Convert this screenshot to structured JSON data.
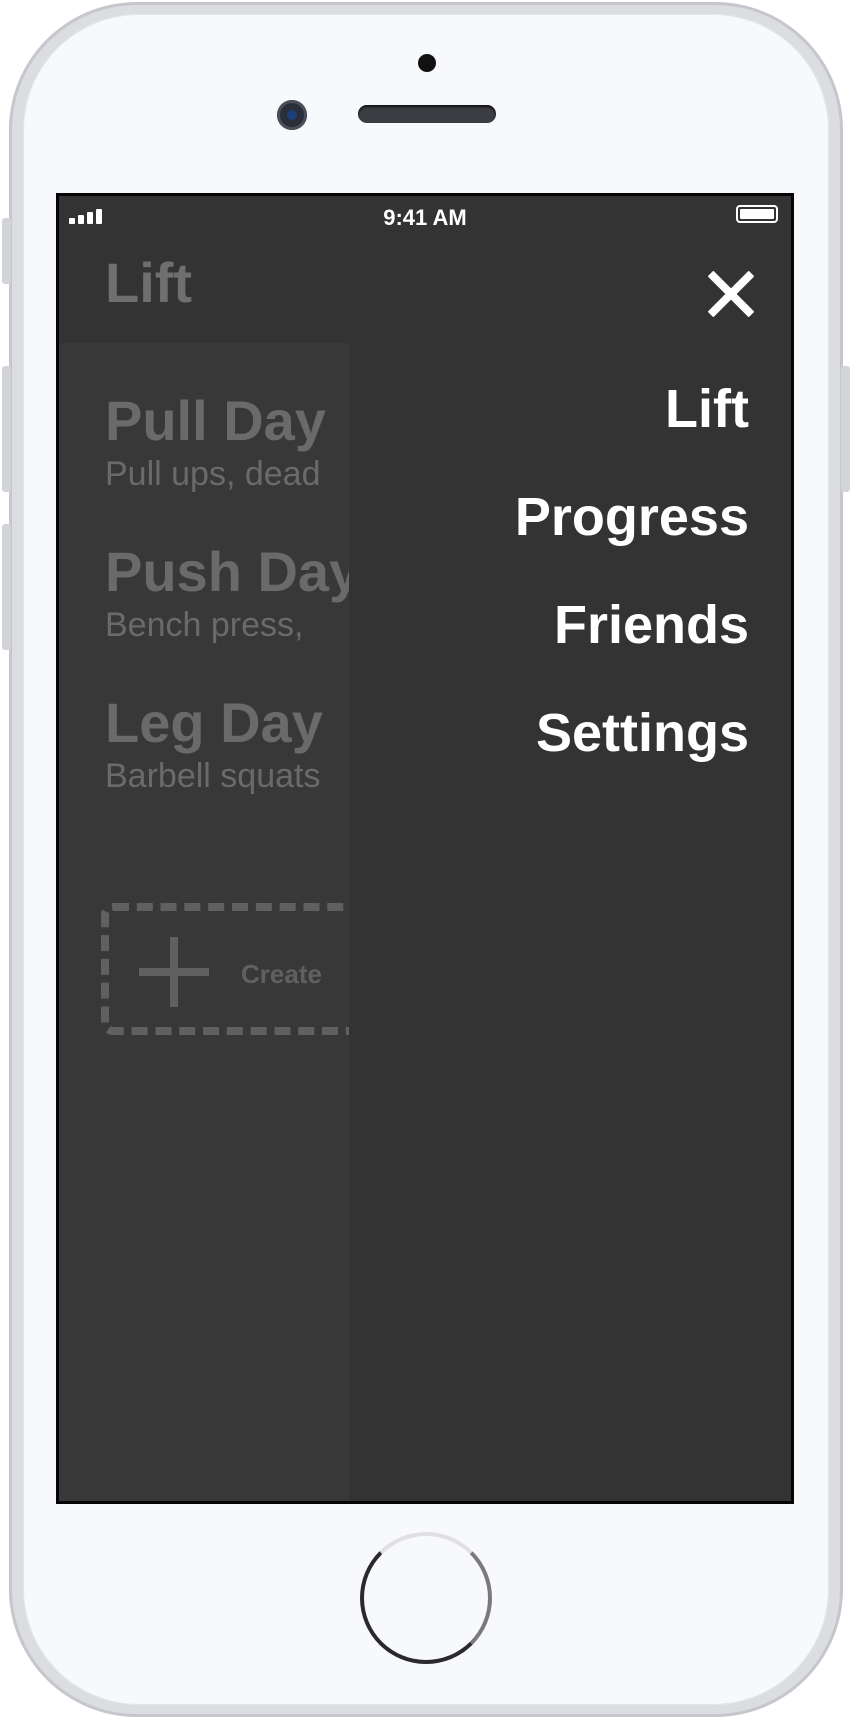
{
  "status_bar": {
    "time": "9:41 AM"
  },
  "background_page": {
    "title": "Lift",
    "workouts": [
      {
        "name": "Pull Day",
        "description": "Pull ups, dead"
      },
      {
        "name": "Push Day",
        "description": "Bench press,"
      },
      {
        "name": "Leg Day",
        "description": "Barbell squats"
      }
    ],
    "create_label": "Create"
  },
  "menu": {
    "close_icon": "close-icon",
    "items": [
      {
        "label": "Lift"
      },
      {
        "label": "Progress"
      },
      {
        "label": "Friends"
      },
      {
        "label": "Settings"
      }
    ]
  },
  "colors": {
    "screen_background": "#333333",
    "menu_text": "#ffffff",
    "dimmed_text": "#6a6a6a"
  }
}
